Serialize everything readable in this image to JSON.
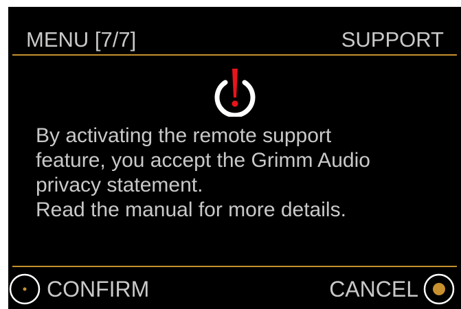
{
  "header": {
    "title": "MENU [7/7]",
    "section": "SUPPORT"
  },
  "dialog": {
    "icon": "power-warning-icon",
    "message_lines": [
      "By activating the remote support",
      "feature, you accept the Grimm Audio",
      "privacy statement.",
      "Read the manual for more details."
    ]
  },
  "footer": {
    "confirm_label": "CONFIRM",
    "cancel_label": "CANCEL",
    "confirm_icon": "ring-dot-icon",
    "cancel_icon": "ring-filled-dot-icon"
  },
  "colors": {
    "background": "#000000",
    "text": "#c9c9c9",
    "accent": "#c8902e",
    "warning": "#e8141c",
    "icon_ring": "#ffffff"
  }
}
